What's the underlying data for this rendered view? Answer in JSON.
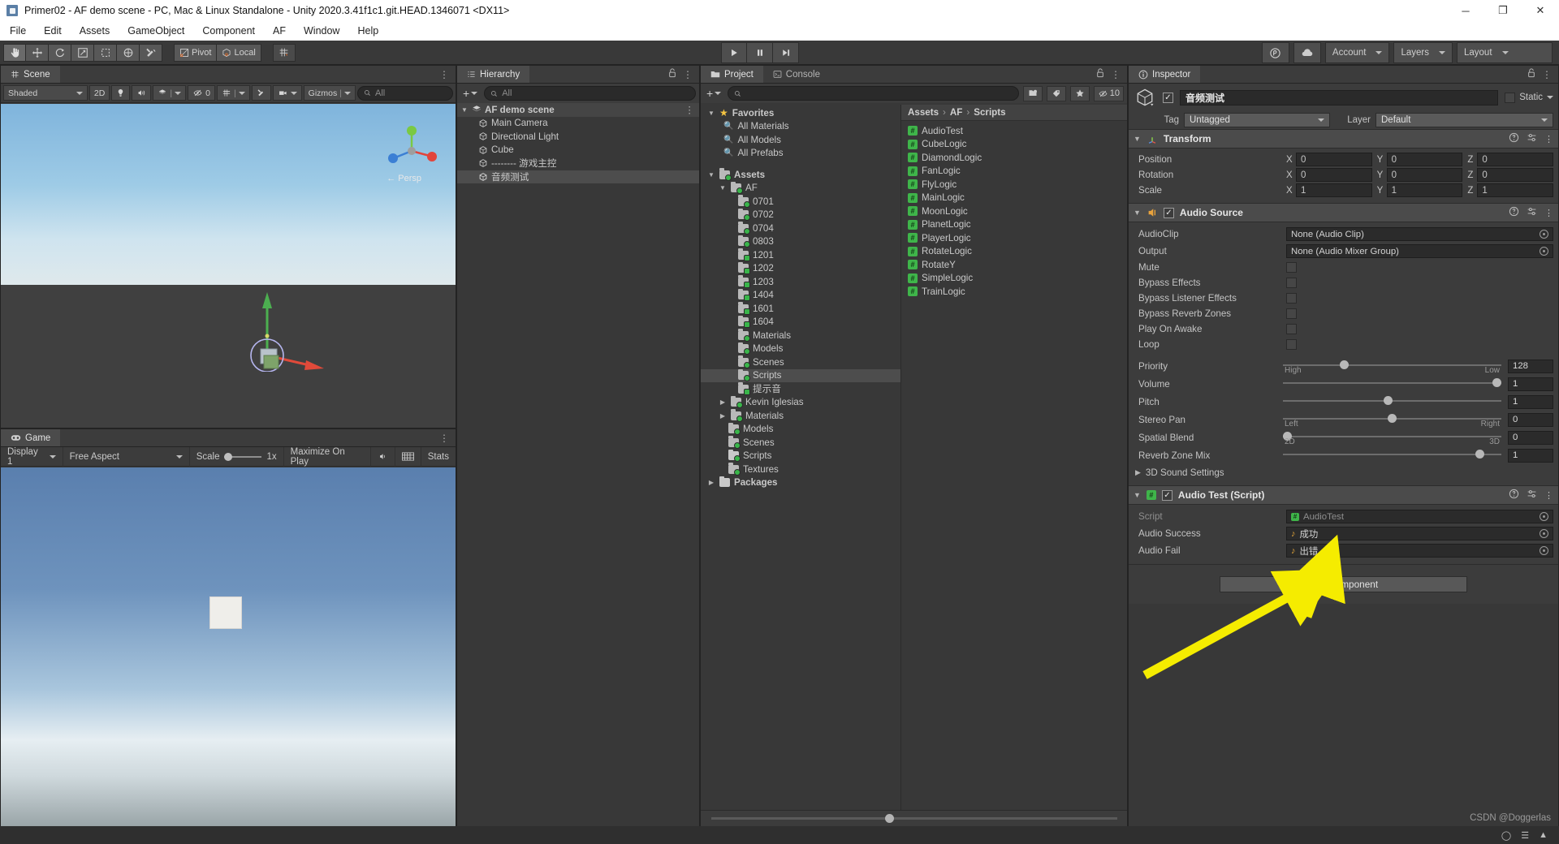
{
  "window": {
    "title": "Primer02 - AF demo scene - PC, Mac & Linux Standalone - Unity 2020.3.41f1c1.git.HEAD.1346071 <DX11>",
    "minimize": "─",
    "maximize": "❐",
    "close": "✕"
  },
  "menu": {
    "items": [
      "File",
      "Edit",
      "Assets",
      "GameObject",
      "Component",
      "AF",
      "Window",
      "Help"
    ]
  },
  "toolbar": {
    "tools": [
      "hand-tool",
      "move-tool",
      "rotate-tool",
      "scale-tool",
      "rect-tool",
      "transform-tool",
      "custom-tool"
    ],
    "pivot": "Pivot",
    "local": "Local",
    "snap": "grid-snap",
    "play": "▶",
    "pause": "❙❙",
    "step": "▶❙",
    "collab": "collab-icon",
    "cloud": "cloud-icon",
    "account": "Account",
    "layers": "Layers",
    "layout": "Layout"
  },
  "scene": {
    "tab": "Scene",
    "shading": "Shaded",
    "mode2d": "2D",
    "lighting": "lighting-icon",
    "audio": "audio-icon",
    "fx": "fx-icon",
    "hidden_count": "0",
    "grid": "grid-icon",
    "gizmos": "Gizmos",
    "search_placeholder": "All",
    "persp_label": "Persp"
  },
  "game": {
    "tab": "Game",
    "display": "Display 1",
    "aspect": "Free Aspect",
    "scale_label": "Scale",
    "scale_value": "1x",
    "maximize": "Maximize On Play",
    "mute": "mute-icon",
    "stats": "Stats"
  },
  "hierarchy": {
    "tab": "Hierarchy",
    "search_placeholder": "All",
    "add_label": "+",
    "lock_icon": "lock-icon",
    "menu_icon": "kebab-menu-icon",
    "scene_name": "AF demo scene",
    "items": [
      {
        "label": "Main Camera",
        "selected": false
      },
      {
        "label": "Directional Light",
        "selected": false
      },
      {
        "label": "Cube",
        "selected": false
      },
      {
        "label": "-------- 游戏主控",
        "selected": false
      },
      {
        "label": "音频测试",
        "selected": true
      }
    ]
  },
  "project": {
    "tab": "Project",
    "console_tab": "Console",
    "search_placeholder": "",
    "hidden_count": "10",
    "favorites_label": "Favorites",
    "favorites": [
      "All Materials",
      "All Models",
      "All Prefabs"
    ],
    "assets_label": "Assets",
    "af_label": "AF",
    "af_folders": [
      "0701",
      "0702",
      "0704",
      "0803",
      "1201",
      "1202",
      "1203",
      "1404",
      "1601",
      "1604",
      "Materials",
      "Models",
      "Scenes",
      "Scripts",
      "提示音"
    ],
    "selected_folder": "Scripts",
    "root_folders": [
      "Kevin Iglesias",
      "Materials",
      "Models",
      "Scenes",
      "Scripts",
      "Textures"
    ],
    "packages_label": "Packages",
    "breadcrumb": [
      "Assets",
      "AF",
      "Scripts"
    ],
    "scripts": [
      "AudioTest",
      "CubeLogic",
      "DiamondLogic",
      "FanLogic",
      "FlyLogic",
      "MainLogic",
      "MoonLogic",
      "PlanetLogic",
      "PlayerLogic",
      "RotateLogic",
      "RotateY",
      "SimpleLogic",
      "TrainLogic"
    ]
  },
  "inspector": {
    "tab": "Inspector",
    "lock_icon": "lock-icon",
    "menu_icon": "kebab-menu-icon",
    "object_name": "音频测试",
    "static_label": "Static",
    "tag_label": "Tag",
    "tag_value": "Untagged",
    "layer_label": "Layer",
    "layer_value": "Default",
    "transform": {
      "title": "Transform",
      "rows": [
        {
          "label": "Position",
          "x": "0",
          "y": "0",
          "z": "0"
        },
        {
          "label": "Rotation",
          "x": "0",
          "y": "0",
          "z": "0"
        },
        {
          "label": "Scale",
          "x": "1",
          "y": "1",
          "z": "1"
        }
      ]
    },
    "audio_source": {
      "title": "Audio Source",
      "clip_label": "AudioClip",
      "clip_value": "None (Audio Clip)",
      "output_label": "Output",
      "output_value": "None (Audio Mixer Group)",
      "checkboxes": [
        {
          "label": "Mute",
          "checked": false
        },
        {
          "label": "Bypass Effects",
          "checked": false
        },
        {
          "label": "Bypass Listener Effects",
          "checked": false
        },
        {
          "label": "Bypass Reverb Zones",
          "checked": false
        },
        {
          "label": "Play On Awake",
          "checked": false
        },
        {
          "label": "Loop",
          "checked": false
        }
      ],
      "sliders": [
        {
          "label": "Priority",
          "value": "128",
          "pos": 26,
          "left": "High",
          "right": "Low"
        },
        {
          "label": "Volume",
          "value": "1",
          "pos": 100,
          "left": "",
          "right": ""
        },
        {
          "label": "Pitch",
          "value": "1",
          "pos": 46,
          "left": "",
          "right": ""
        },
        {
          "label": "Stereo Pan",
          "value": "0",
          "pos": 50,
          "left": "Left",
          "right": "Right"
        },
        {
          "label": "Spatial Blend",
          "value": "0",
          "pos": 0,
          "left": "2D",
          "right": "3D"
        },
        {
          "label": "Reverb Zone Mix",
          "value": "1",
          "pos": 88,
          "left": "",
          "right": ""
        }
      ],
      "sound_settings_label": "3D Sound Settings"
    },
    "audio_test": {
      "title": "Audio Test (Script)",
      "script_label": "Script",
      "script_value": "AudioTest",
      "fields": [
        {
          "label": "Audio Success",
          "value": "成功"
        },
        {
          "label": "Audio Fail",
          "value": "出错"
        }
      ]
    },
    "add_component": "Add Component"
  },
  "watermark": "CSDN @Doggerlas",
  "colors": {
    "panel_bg": "#383838",
    "header_bg": "#3c3c3c",
    "accent_yellow": "#f5ec00",
    "green_script": "#3fb54a"
  }
}
